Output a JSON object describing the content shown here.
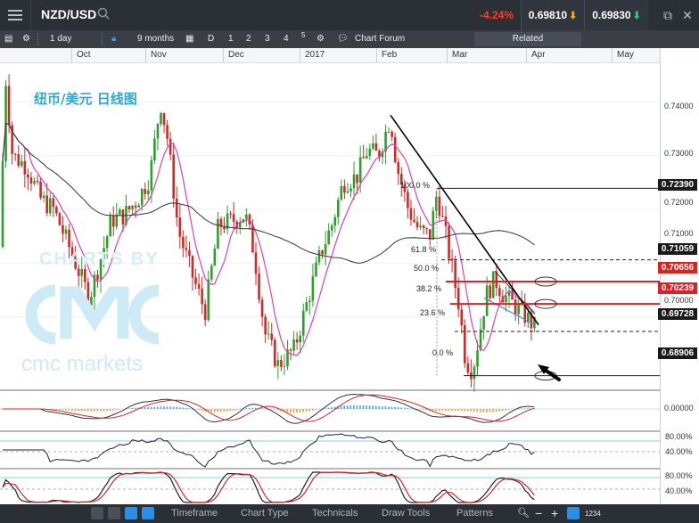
{
  "header": {
    "symbol": "NZD/USD",
    "change": "-4.24%",
    "sell_price": "0.69810",
    "buy_price": "0.69830"
  },
  "toolbar": {
    "interval": "1 day",
    "range": "9 months",
    "day_button": "D",
    "layout_buttons": [
      "1",
      "2",
      "3",
      "4",
      "5"
    ],
    "chart_forum": "Chart Forum",
    "related": "Related"
  },
  "chart_title": "纽币/美元 日线图",
  "watermark": {
    "top": "CHARTS BY",
    "bottom": "cmc markets"
  },
  "months": [
    "Oct",
    "Nov",
    "Dec",
    "2017",
    "Feb",
    "Mar",
    "Apr",
    "May"
  ],
  "price_axis": {
    "ticks": [
      "0.74000",
      "0.73000",
      "0.72000",
      "0.71000",
      "0.70000"
    ],
    "flags": [
      {
        "label": "0.72390",
        "color": "#1a1a1a"
      },
      {
        "label": "0.71059",
        "color": "#1a1a1a"
      },
      {
        "label": "0.70656",
        "color": "#e02020"
      },
      {
        "label": "0.70239",
        "color": "#e02020"
      },
      {
        "label": "0.69728",
        "color": "#1a1a1a"
      },
      {
        "label": "0.68906",
        "color": "#1a1a1a"
      }
    ]
  },
  "fibonacci": [
    "100.0 %",
    "61.8 %",
    "50.0 %",
    "38.2 %",
    "23.6 %",
    "0.0 %"
  ],
  "indicator_axis": {
    "macd": "0.00000",
    "rsi_top": "80.00%",
    "rsi_bottom": "40.00%",
    "stoch_top": "80.00%",
    "stoch_bottom": "40.00%"
  },
  "bottom_bar": [
    "Timeframe",
    "Chart Type",
    "Technicals",
    "Draw Tools",
    "Patterns"
  ],
  "zoom_label": "1234",
  "chart_data": {
    "type": "candlestick",
    "title": "纽币/美元 日线图",
    "x_range": [
      "Oct",
      "May"
    ],
    "ylim": [
      0.687,
      0.747
    ],
    "y_ticks": [
      0.74,
      0.73,
      0.72,
      0.71,
      0.7
    ],
    "trendline": {
      "from": "Jan",
      "to": "Mar",
      "price_from": 0.7375,
      "price_to": 0.6985
    },
    "fibonacci_levels": [
      {
        "label": "100.0 %",
        "price": 0.7239
      },
      {
        "label": "61.8 %",
        "price": 0.71059
      },
      {
        "label": "50.0 %",
        "price": 0.70656
      },
      {
        "label": "38.2 %",
        "price": 0.70239
      },
      {
        "label": "23.6 %",
        "price": 0.69728
      },
      {
        "label": "0.0 %",
        "price": 0.68906
      }
    ],
    "highlighted_levels": [
      0.70656,
      0.70239
    ],
    "last_price": 0.6981,
    "colors": {
      "up": "#2ca02c",
      "down": "#d62728",
      "ma_fast": "#e040b0",
      "ma_slow": "#333333",
      "trend": "#000000",
      "resistance": "#e02020"
    },
    "indicators": [
      "MACD",
      "RSI",
      "Stochastic"
    ]
  }
}
